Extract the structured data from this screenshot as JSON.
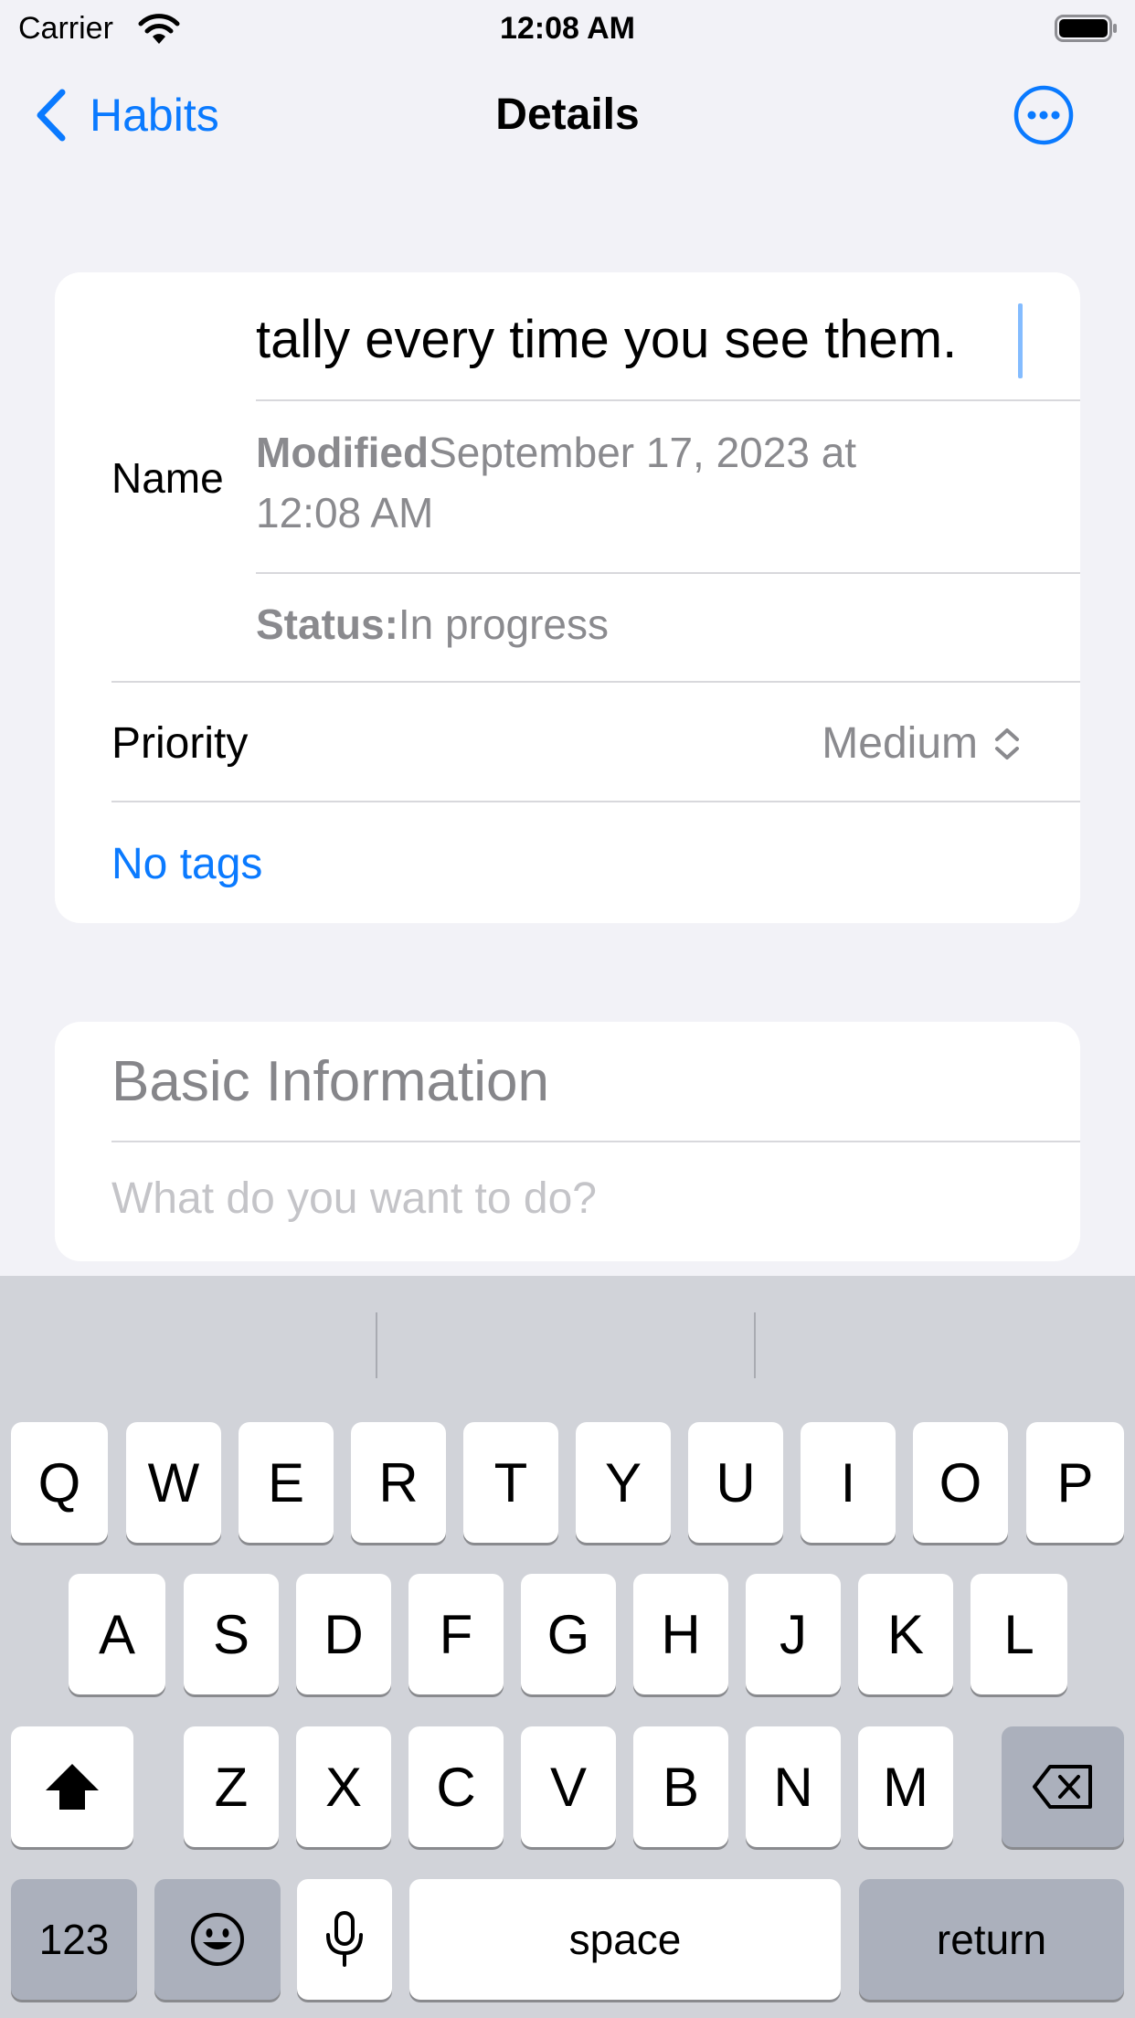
{
  "status_bar": {
    "carrier": "Carrier",
    "time": "12:08 AM"
  },
  "nav": {
    "back_label": "Habits",
    "title": "Details"
  },
  "card": {
    "name_label": "Name",
    "name_value": "tally every time you see them.",
    "modified_label": "Modified",
    "modified_value": "September 17, 2023 at 12:08 AM",
    "status_label": "Status:",
    "status_value": "In progress",
    "priority_label": "Priority",
    "priority_value": "Medium",
    "tags_label": "No tags"
  },
  "basic_info": {
    "title": "Basic Information",
    "placeholder": "What do you want to do?"
  },
  "keyboard": {
    "row1": [
      "Q",
      "W",
      "E",
      "R",
      "T",
      "Y",
      "U",
      "I",
      "O",
      "P"
    ],
    "row2": [
      "A",
      "S",
      "D",
      "F",
      "G",
      "H",
      "J",
      "K",
      "L"
    ],
    "row3": [
      "Z",
      "X",
      "C",
      "V",
      "B",
      "N",
      "M"
    ],
    "numbers_label": "123",
    "space_label": "space",
    "return_label": "return"
  },
  "colors": {
    "accent": "#0a7aff",
    "background": "#f2f2f7",
    "keyboard": "#d1d3d9"
  }
}
